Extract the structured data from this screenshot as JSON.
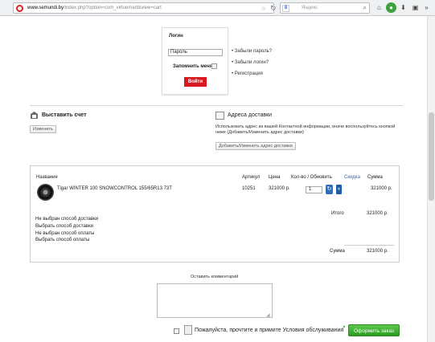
{
  "browser": {
    "url_host": "www.semundi.by",
    "url_path": "/index.php?option=com_virtuemart&view=cart",
    "search_placeholder": "Яндекс",
    "search_engine_letter": "8"
  },
  "login": {
    "title": "Логин",
    "password_value": "Пароль",
    "remember_label": "Запомнить меня",
    "submit_label": "Войти",
    "links": [
      "Забыли пароль?",
      "Забыли логин?",
      "Регистрация"
    ]
  },
  "invoice": {
    "title": "Выставить счет",
    "button_label": "Изменить"
  },
  "shipping_address": {
    "title": "Адреса доставки",
    "text": "Использовать адрес из вашей Контактной информации, иначе воспользуйтесь кнопкой ниже (Добавить/Изменить адрес доставки)",
    "button_label": "Добавить/Изменить адрес доставки"
  },
  "order_table": {
    "headers": {
      "name": "Название",
      "sku": "Артикул",
      "price": "Цена",
      "qty": "Кол-во / Обновить",
      "discount": "Скидка",
      "total": "Сумма"
    },
    "items": [
      {
        "name": "Tigar WINTER 100 SNOWCONTROL 155/65R13 73T",
        "sku": "10251",
        "price": "321000 р.",
        "qty": "1",
        "total": "321000 р."
      }
    ],
    "subtotal_label": "Итого",
    "subtotal_value": "321000 р.",
    "status_lines": [
      "Не выбран способ доставки",
      "Выбрать способ доставки",
      "Не выбран способ оплаты",
      "Выбрать способ оплаты"
    ],
    "sum_label": "Сумма",
    "sum_value": "321000 р."
  },
  "comment": {
    "label": "Оставить комментарий"
  },
  "footer": {
    "tos_text": "Пожалуйста, прочтите и примите Условия обслуживания",
    "order_button": "Оформить заказ"
  },
  "colors": {
    "login_button": "#d81920",
    "order_button": "#3aa52e",
    "header_blue": "#356aa0"
  }
}
